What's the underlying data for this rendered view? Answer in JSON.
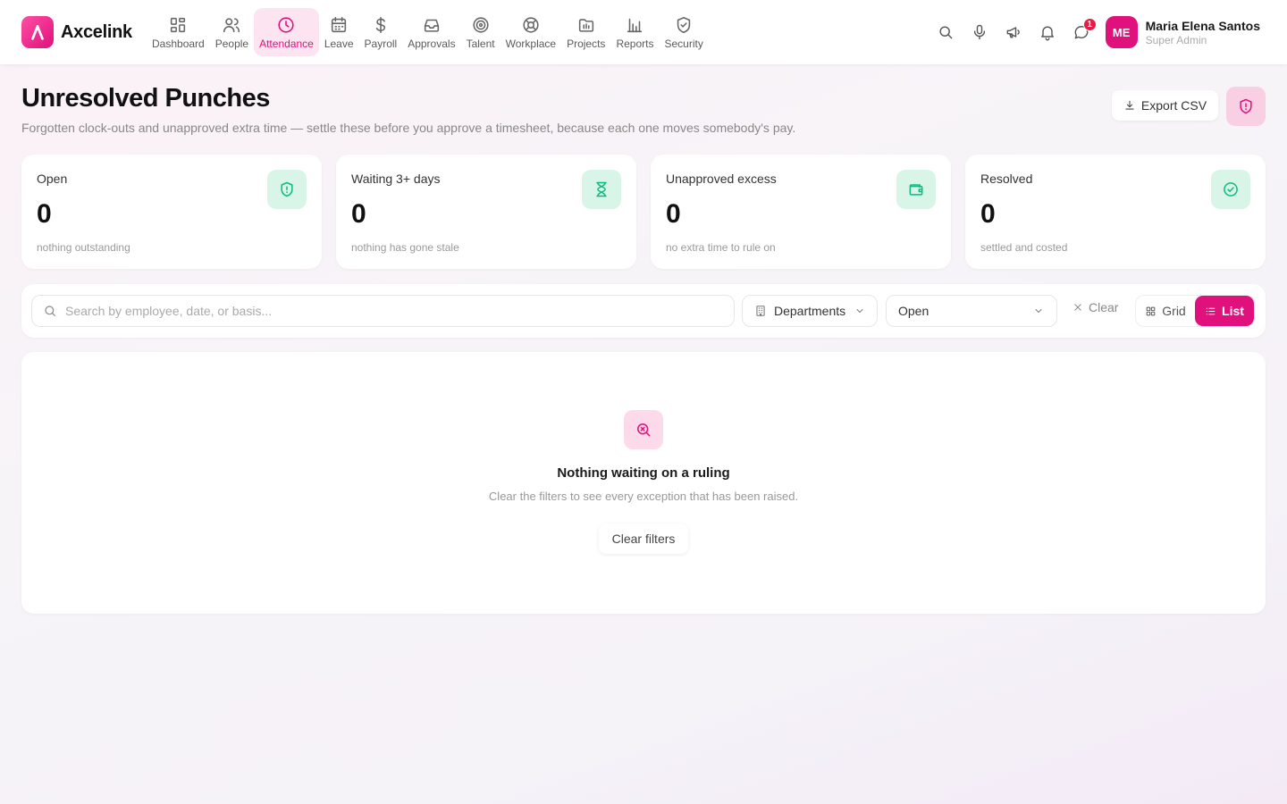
{
  "brand": {
    "name": "Axcelink"
  },
  "nav": [
    {
      "label": "Dashboard",
      "icon": "dashboard-icon",
      "active": false
    },
    {
      "label": "People",
      "icon": "people-icon",
      "active": false
    },
    {
      "label": "Attendance",
      "icon": "clock-icon",
      "active": true
    },
    {
      "label": "Leave",
      "icon": "calendar-icon",
      "active": false
    },
    {
      "label": "Payroll",
      "icon": "dollar-icon",
      "active": false
    },
    {
      "label": "Approvals",
      "icon": "inbox-icon",
      "active": false
    },
    {
      "label": "Talent",
      "icon": "target-icon",
      "active": false
    },
    {
      "label": "Workplace",
      "icon": "lifebuoy-icon",
      "active": false
    },
    {
      "label": "Projects",
      "icon": "folder-icon",
      "active": false
    },
    {
      "label": "Reports",
      "icon": "bar-chart-icon",
      "active": false
    },
    {
      "label": "Security",
      "icon": "shield-icon",
      "active": false
    }
  ],
  "tools": {
    "messages_badge": "1"
  },
  "user": {
    "initials": "ME",
    "name": "Maria Elena Santos",
    "role": "Super Admin"
  },
  "header": {
    "title": "Unresolved Punches",
    "subtitle": "Forgotten clock-outs and unapproved extra time — settle these before you approve a timesheet, because each one moves somebody's pay.",
    "export_label": "Export CSV"
  },
  "stats": [
    {
      "label": "Open",
      "value": "0",
      "note": "nothing outstanding",
      "icon": "shield-alert-icon"
    },
    {
      "label": "Waiting 3+ days",
      "value": "0",
      "note": "nothing has gone stale",
      "icon": "hourglass-icon"
    },
    {
      "label": "Unapproved excess",
      "value": "0",
      "note": "no extra time to rule on",
      "icon": "wallet-icon"
    },
    {
      "label": "Resolved",
      "value": "0",
      "note": "settled and costed",
      "icon": "check-circle-icon"
    }
  ],
  "filters": {
    "search_placeholder": "Search by employee, date, or basis...",
    "search_value": "",
    "departments_label": "Departments",
    "status_value": "Open",
    "clear_label": "Clear",
    "grid_label": "Grid",
    "list_label": "List"
  },
  "empty": {
    "title": "Nothing waiting on a ruling",
    "subtitle": "Clear the filters to see every exception that has been raised.",
    "button_label": "Clear filters"
  },
  "colors": {
    "accent": "#e0107d",
    "success": "#10b981",
    "success_bg": "#d9f5e8",
    "badge": "#e11d48"
  }
}
